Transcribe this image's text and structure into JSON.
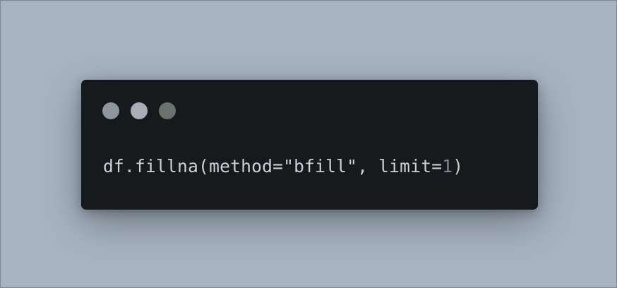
{
  "window": {
    "controls": [
      {
        "icon": "window-dot-icon",
        "color": "#8e96a0"
      },
      {
        "icon": "window-dot-icon",
        "color": "#a7aeb7"
      },
      {
        "icon": "window-dot-icon",
        "color": "#69736c"
      }
    ]
  },
  "code": {
    "line_before": "df.fillna(method=\"bfill\", limit=",
    "number": "1",
    "line_after": ")"
  },
  "colors": {
    "background": "#a9b4c1",
    "window_bg": "#171a1c",
    "code_text": "#c9d1d8",
    "number_token": "#7c8896"
  }
}
